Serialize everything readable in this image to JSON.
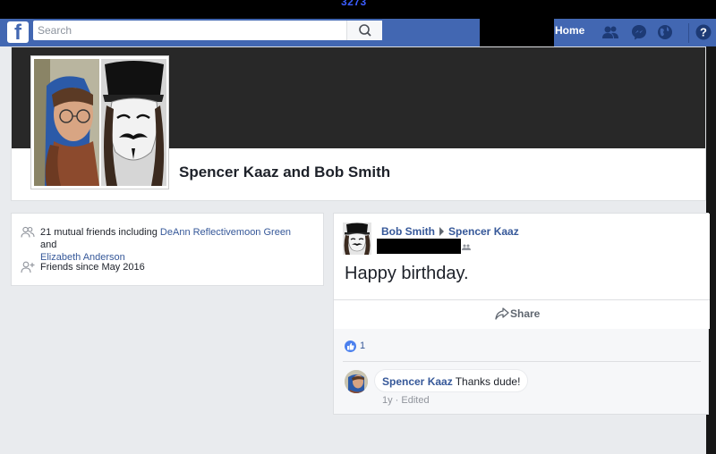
{
  "top_bar": {
    "counter": "3273"
  },
  "nav": {
    "search_placeholder": "Search",
    "home_label": "Home",
    "icons": [
      "friends-icon",
      "messenger-icon",
      "globe-icon",
      "help-icon"
    ],
    "accent_color": "#4267b2"
  },
  "header": {
    "title": "Spencer Kaaz and Bob Smith"
  },
  "intro": {
    "mutual_prefix": "21 mutual friends including ",
    "mutual_friend_1": "DeAnn Reflectivemoon Green",
    "mutual_and": " and",
    "mutual_friend_2": "Elizabeth Anderson",
    "friends_since": "Friends since May 2016"
  },
  "post": {
    "author": "Bob Smith",
    "target": "Spencer Kaaz",
    "text": "Happy birthday.",
    "share_label": "Share",
    "like_count": "1",
    "comment": {
      "author": "Spencer Kaaz",
      "text": "Thanks dude!",
      "time": "1y",
      "separator": " · ",
      "edited": "Edited"
    }
  }
}
